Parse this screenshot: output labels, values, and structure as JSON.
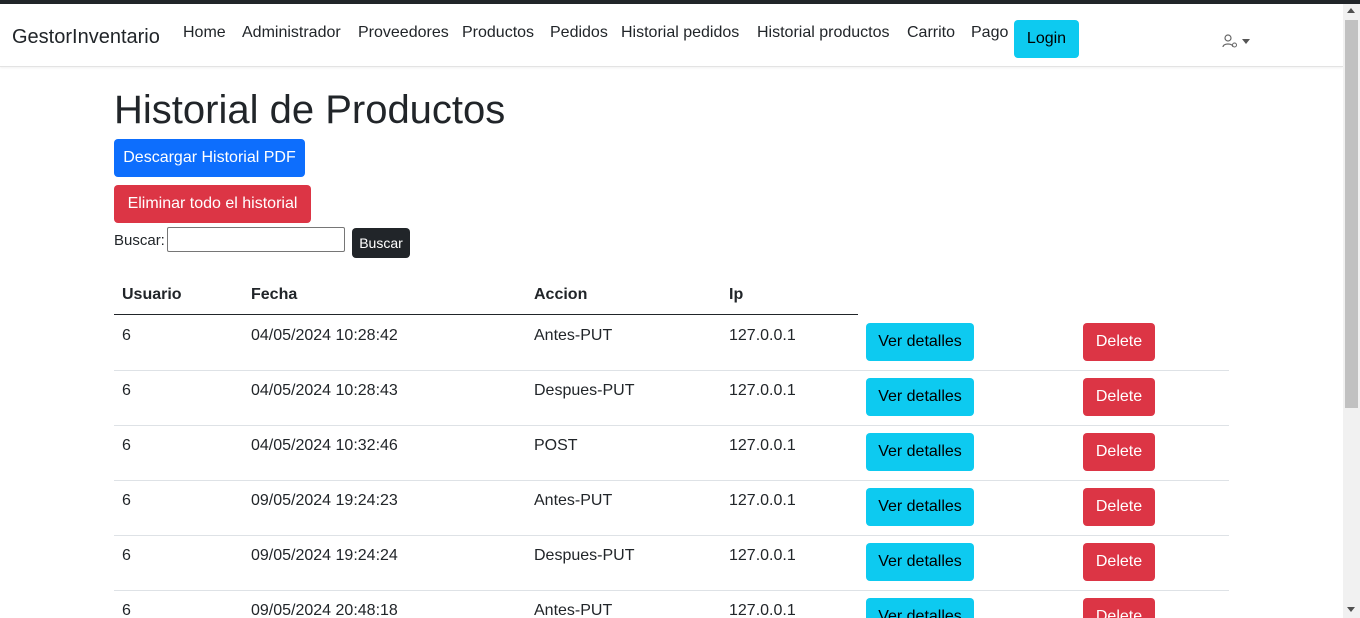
{
  "navbar": {
    "brand": "GestorInventario",
    "items": [
      "Home",
      "Administrador",
      "Proveedores",
      "Productos",
      "Pedidos",
      "Historial pedidos",
      "Historial productos",
      "Carrito",
      "Pago"
    ],
    "login_label": "Login"
  },
  "page": {
    "title": "Historial de Productos",
    "download_pdf_label": "Descargar Historial PDF",
    "delete_all_label": "Eliminar todo el historial",
    "search_label": "Buscar:",
    "search_value": "",
    "search_button_label": "Buscar"
  },
  "table": {
    "headers": [
      "Usuario",
      "Fecha",
      "Accion",
      "Ip"
    ],
    "rows": [
      {
        "usuario": "6",
        "fecha": "04/05/2024 10:28:42",
        "accion": "Antes-PUT",
        "ip": "127.0.0.1"
      },
      {
        "usuario": "6",
        "fecha": "04/05/2024 10:28:43",
        "accion": "Despues-PUT",
        "ip": "127.0.0.1"
      },
      {
        "usuario": "6",
        "fecha": "04/05/2024 10:32:46",
        "accion": "POST",
        "ip": "127.0.0.1"
      },
      {
        "usuario": "6",
        "fecha": "09/05/2024 19:24:23",
        "accion": "Antes-PUT",
        "ip": "127.0.0.1"
      },
      {
        "usuario": "6",
        "fecha": "09/05/2024 19:24:24",
        "accion": "Despues-PUT",
        "ip": "127.0.0.1"
      },
      {
        "usuario": "6",
        "fecha": "09/05/2024 20:48:18",
        "accion": "Antes-PUT",
        "ip": "127.0.0.1"
      }
    ],
    "details_label": "Ver detalles",
    "delete_label": "Delete"
  },
  "colors": {
    "primary": "#0d6efd",
    "danger": "#dc3545",
    "info": "#0dcaf0",
    "dark": "#212529"
  },
  "icons": {
    "user_menu": "user-gear-icon",
    "dropdown": "caret-down-icon"
  }
}
